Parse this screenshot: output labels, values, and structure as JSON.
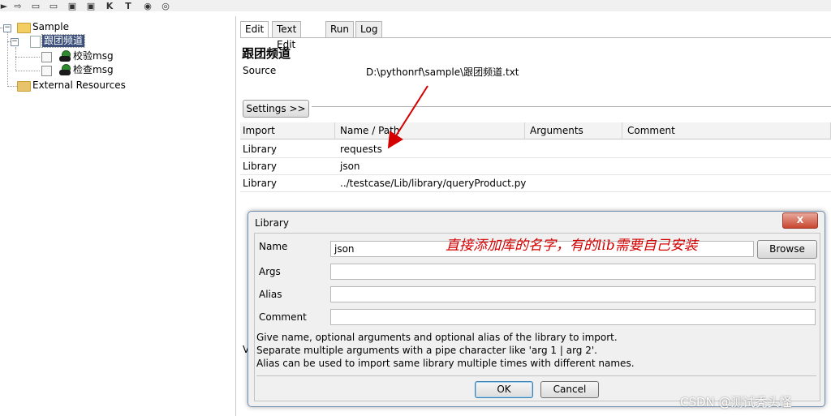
{
  "tree": {
    "root": "Sample",
    "suite": "跟团频道",
    "keywords": [
      "校验msg",
      "检查msg"
    ],
    "external": "External Resources"
  },
  "tabs": [
    "Edit",
    "Text Edit",
    "Run",
    "Log"
  ],
  "panel": {
    "title": "跟团频道",
    "source_label": "Source",
    "source_value": "D:\\pythonrf\\sample\\跟团频道.txt",
    "settings_label": "Settings >>"
  },
  "table": {
    "headers": [
      "Import",
      "Name / Path",
      "Arguments",
      "Comment"
    ],
    "rows": [
      [
        "Library",
        "requests",
        "",
        ""
      ],
      [
        "Library",
        "json",
        "",
        ""
      ],
      [
        "Library",
        "../testcase/Lib/library/queryProduct.py",
        "",
        ""
      ]
    ]
  },
  "dialog": {
    "title": "Library",
    "close": "X",
    "fields": {
      "name_label": "Name",
      "name_value": "json",
      "args_label": "Args",
      "alias_label": "Alias",
      "comment_label": "Comment"
    },
    "browse": "Browse",
    "help": [
      "Give name, optional arguments and optional alias of the library to import.",
      "Separate multiple arguments with a pipe character like 'arg 1 | arg 2'.",
      "Alias can be used to import same library multiple times with different names."
    ],
    "ok": "OK",
    "cancel": "Cancel"
  },
  "annotation": "直接添加库的名字，有的lib需要自己安装",
  "watermark": "CSDN @测试秃头怪",
  "fragment": "V",
  "toolbar": {
    "k": "K",
    "t": "T"
  },
  "colors": {
    "accent": "#d40000",
    "selection": "#3b4f7a"
  }
}
